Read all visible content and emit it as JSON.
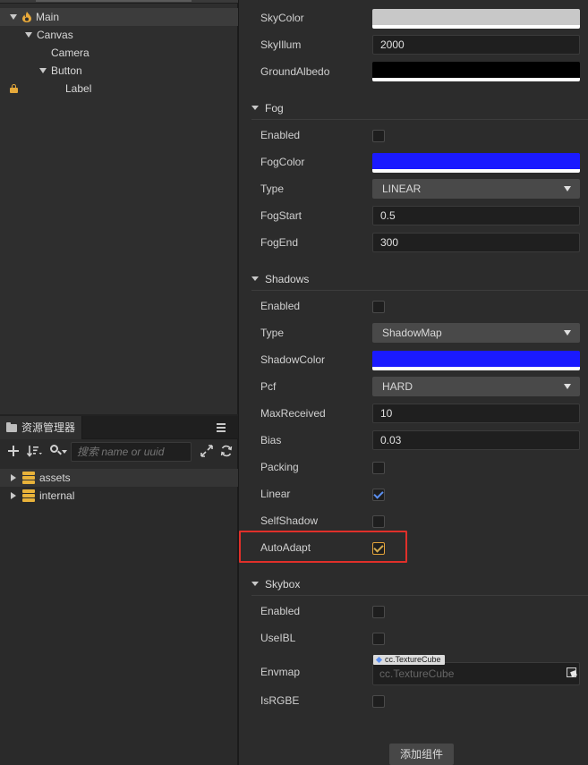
{
  "hierarchy": {
    "items": [
      {
        "label": "Main"
      },
      {
        "label": "Canvas"
      },
      {
        "label": "Camera"
      },
      {
        "label": "Button"
      },
      {
        "label": "Label"
      }
    ]
  },
  "assets_panel": {
    "title": "资源管理器",
    "search_placeholder": "搜索 name or uuid",
    "items": [
      {
        "label": "assets"
      },
      {
        "label": "internal"
      }
    ]
  },
  "inspector": {
    "top": {
      "sky_color_label": "SkyColor",
      "sky_color": "#c8c8c8",
      "sky_illum_label": "SkyIllum",
      "sky_illum": "2000",
      "ground_albedo_label": "GroundAlbedo",
      "ground_albedo": "#000000"
    },
    "fog": {
      "title": "Fog",
      "enabled_label": "Enabled",
      "enabled": false,
      "fog_color_label": "FogColor",
      "fog_color": "#1a1aff",
      "type_label": "Type",
      "type": "LINEAR",
      "fog_start_label": "FogStart",
      "fog_start": "0.5",
      "fog_end_label": "FogEnd",
      "fog_end": "300"
    },
    "shadows": {
      "title": "Shadows",
      "enabled_label": "Enabled",
      "enabled": false,
      "type_label": "Type",
      "type": "ShadowMap",
      "shadow_color_label": "ShadowColor",
      "shadow_color": "#1a1aff",
      "pcf_label": "Pcf",
      "pcf": "HARD",
      "max_received_label": "MaxReceived",
      "max_received": "10",
      "bias_label": "Bias",
      "bias": "0.03",
      "packing_label": "Packing",
      "packing": false,
      "linear_label": "Linear",
      "linear": true,
      "self_shadow_label": "SelfShadow",
      "self_shadow": false,
      "auto_adapt_label": "AutoAdapt",
      "auto_adapt": true
    },
    "skybox": {
      "title": "Skybox",
      "enabled_label": "Enabled",
      "enabled": false,
      "use_ibl_label": "UseIBL",
      "use_ibl": false,
      "envmap_label": "Envmap",
      "envmap_type_tag": "cc.TextureCube",
      "envmap_placeholder": "cc.TextureCube",
      "is_rgbe_label": "IsRGBE",
      "is_rgbe": false
    },
    "add_component_label": "添加组件"
  },
  "colors": {
    "accent_blue": "#5b8ff0",
    "highlight_red": "#e0302a",
    "lock_orange": "#e6a93a"
  }
}
